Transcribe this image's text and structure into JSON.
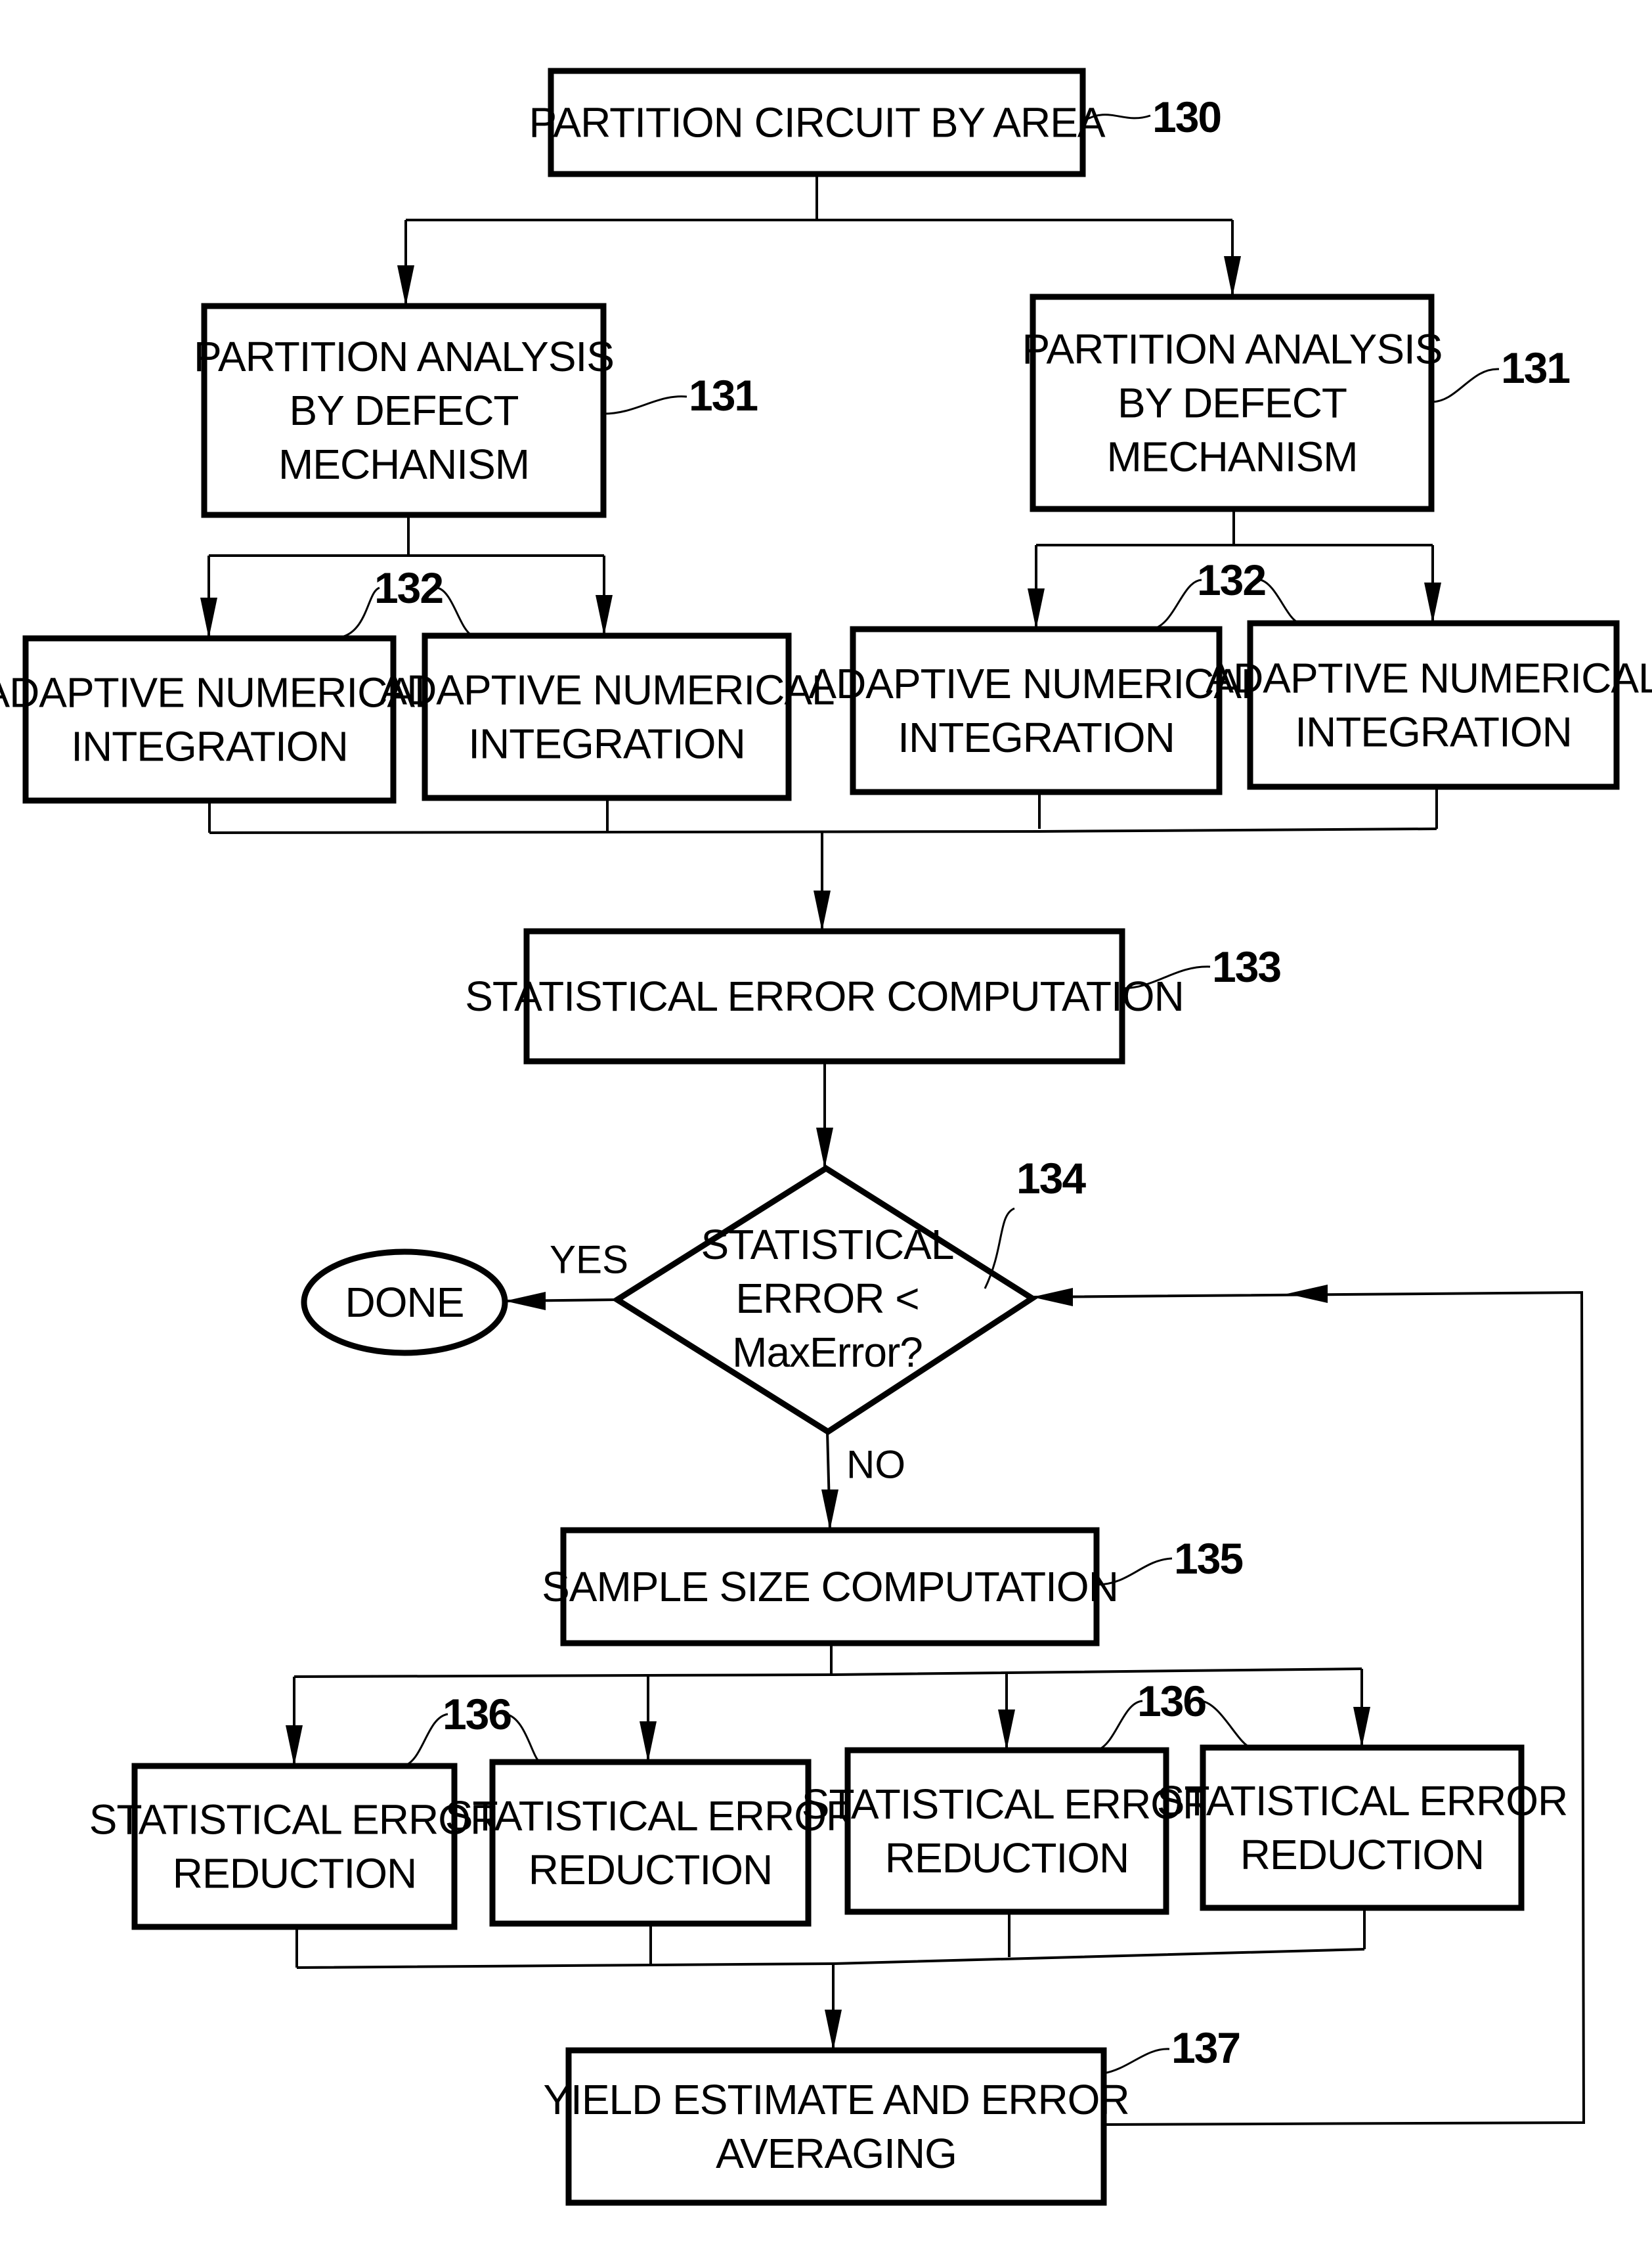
{
  "figure": {
    "type": "flowchart",
    "colors": {
      "ink": "#000000",
      "paper": "#ffffff"
    }
  },
  "nodes": {
    "n130": {
      "ref": "130",
      "shape": "rect",
      "lines": [
        "PARTITION CIRCUIT BY AREA"
      ]
    },
    "n131a": {
      "ref": "131",
      "shape": "rect",
      "lines": [
        "PARTITION ANALYSIS",
        "BY DEFECT",
        "MECHANISM"
      ]
    },
    "n131b": {
      "ref": "131",
      "shape": "rect",
      "lines": [
        "PARTITION ANALYSIS",
        "BY DEFECT",
        "MECHANISM"
      ]
    },
    "n132a": {
      "shape": "rect",
      "lines": [
        "ADAPTIVE NUMERICAL",
        "INTEGRATION"
      ]
    },
    "n132b": {
      "shape": "rect",
      "lines": [
        "ADAPTIVE NUMERICAL",
        "INTEGRATION"
      ]
    },
    "n132c": {
      "shape": "rect",
      "lines": [
        "ADAPTIVE NUMERICAL",
        "INTEGRATION"
      ]
    },
    "n132d": {
      "shape": "rect",
      "lines": [
        "ADAPTIVE NUMERICAL",
        "INTEGRATION"
      ]
    },
    "n133": {
      "ref": "133",
      "shape": "rect",
      "lines": [
        "STATISTICAL ERROR COMPUTATION"
      ]
    },
    "n134": {
      "ref": "134",
      "shape": "diamond",
      "lines": [
        "STATISTICAL",
        "ERROR <",
        "MaxError?"
      ]
    },
    "done": {
      "shape": "ellipse",
      "lines": [
        "DONE"
      ]
    },
    "n135": {
      "ref": "135",
      "shape": "rect",
      "lines": [
        "SAMPLE SIZE COMPUTATION"
      ]
    },
    "n136a": {
      "shape": "rect",
      "lines": [
        "STATISTICAL ERROR",
        "REDUCTION"
      ]
    },
    "n136b": {
      "shape": "rect",
      "lines": [
        "STATISTICAL ERROR",
        "REDUCTION"
      ]
    },
    "n136c": {
      "shape": "rect",
      "lines": [
        "STATISTICAL ERROR",
        "REDUCTION"
      ]
    },
    "n136d": {
      "shape": "rect",
      "lines": [
        "STATISTICAL ERROR",
        "REDUCTION"
      ]
    },
    "n137": {
      "ref": "137",
      "shape": "rect",
      "lines": [
        "YIELD ESTIMATE AND ERROR",
        "AVERAGING"
      ]
    }
  },
  "group_refs": {
    "g132_left": "132",
    "g132_right": "132",
    "g136_left": "136",
    "g136_right": "136"
  },
  "edge_labels": {
    "yes": "YES",
    "no": "NO"
  },
  "edges": [
    {
      "from": "n130",
      "to": [
        "n131a",
        "n131b"
      ]
    },
    {
      "from": "n131a",
      "to": [
        "n132a",
        "n132b"
      ]
    },
    {
      "from": "n131b",
      "to": [
        "n132c",
        "n132d"
      ]
    },
    {
      "from": [
        "n132a",
        "n132b",
        "n132c",
        "n132d"
      ],
      "to": "n133"
    },
    {
      "from": "n133",
      "to": "n134"
    },
    {
      "from": "n134",
      "to": "done",
      "label": "YES"
    },
    {
      "from": "n134",
      "to": "n135",
      "label": "NO"
    },
    {
      "from": "n135",
      "to": [
        "n136a",
        "n136b",
        "n136c",
        "n136d"
      ]
    },
    {
      "from": [
        "n136a",
        "n136b",
        "n136c",
        "n136d"
      ],
      "to": "n137"
    },
    {
      "from": "n137",
      "to": "n134",
      "kind": "feedback"
    }
  ]
}
